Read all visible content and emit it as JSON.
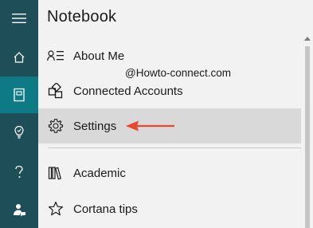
{
  "header": {
    "title": "Notebook"
  },
  "rail": {
    "items": [
      {
        "name": "hamburger-menu-icon"
      },
      {
        "name": "home-icon"
      },
      {
        "name": "notebook-icon",
        "active": true
      },
      {
        "name": "reminders-icon"
      },
      {
        "name": "help-icon"
      },
      {
        "name": "feedback-icon"
      }
    ]
  },
  "menu": {
    "items": [
      {
        "label": "About Me",
        "icon": "about-me-icon"
      },
      {
        "label": "Connected Accounts",
        "icon": "connected-accounts-icon"
      },
      {
        "label": "Settings",
        "icon": "gear-icon",
        "selected": true
      },
      {
        "label": "Academic",
        "icon": "books-icon"
      },
      {
        "label": "Cortana tips",
        "icon": "star-icon"
      }
    ]
  },
  "annotations": {
    "watermark": "@Howto-connect.com",
    "arrow_color": "#e8472a"
  },
  "colors": {
    "rail_bg": "#1e4e57",
    "rail_active": "#0e7a85",
    "panel_bg": "#f2f2f2",
    "selected_bg": "#d9d9d9"
  }
}
